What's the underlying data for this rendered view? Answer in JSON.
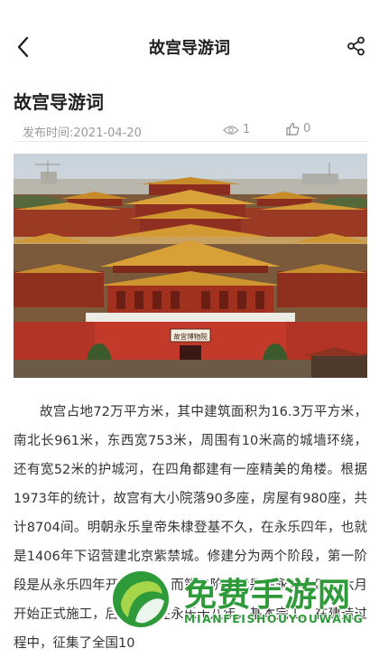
{
  "nav": {
    "title": "故宫导游词",
    "back_icon": "back-arrow-icon",
    "share_icon": "share-icon"
  },
  "article": {
    "title": "故宫导游词",
    "publish_label": "发布时间:",
    "publish_date": "2021-04-20",
    "views": "1",
    "likes": "0",
    "image_sign_text": "故宫博物院",
    "paragraph": "故宫占地72万平方米，其中建筑面积为16.3万平方米，南北长961米，东西宽753米，周围有10米高的城墙环绕，还有宽52米的护城河，在四角都建有一座精美的角楼。根据1973年的统计，故宫有大小院落90多座，房屋有980座，共计8704间。明朝永乐皇帝朱棣登基不久，在永乐四年，也就是1406年下诏营建北京紫禁城。修建分为两个阶段，第一阶段是从永乐四年开始备料，而第二阶段就是在永乐十四年六月开始正式施工，后来到了在永乐十八年，基本完工。在建造过程中，征集了全国10"
  },
  "watermark": {
    "brand_cn": "免费手游网",
    "brand_en": "MIANFEISHOUYOUWANG"
  },
  "colors": {
    "accent_red": "#c0392b",
    "roof_yellow": "#d89a2e",
    "watermark_green": "#2f9a3a"
  }
}
